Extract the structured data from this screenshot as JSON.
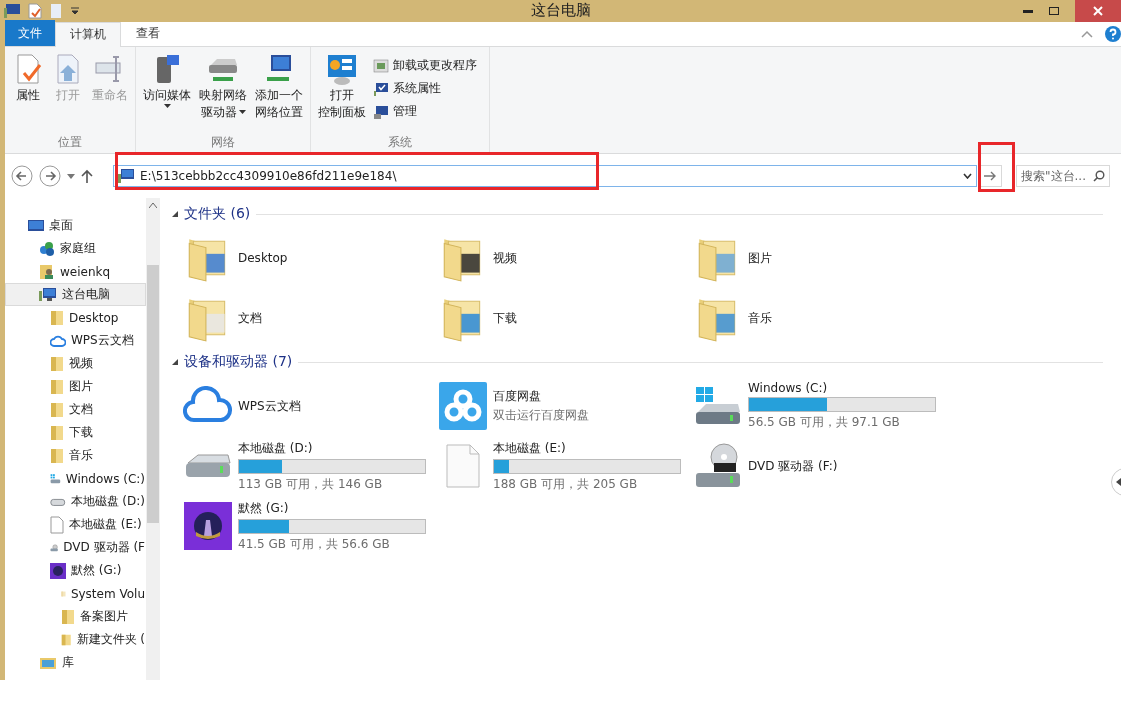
{
  "window": {
    "title": "这台电脑"
  },
  "ribbon_tabs": [
    {
      "label": "文件",
      "kind": "file",
      "selected": false
    },
    {
      "label": "计算机",
      "kind": "tab",
      "selected": true
    },
    {
      "label": "查看",
      "kind": "tab",
      "selected": false
    }
  ],
  "ribbon_groups": [
    {
      "label": "位置",
      "buttons": [
        {
          "kind": "large",
          "lines": [
            "属性"
          ],
          "disabled": false
        },
        {
          "kind": "large",
          "lines": [
            "打开"
          ],
          "disabled": true
        },
        {
          "kind": "large",
          "lines": [
            "重命名"
          ],
          "disabled": true
        }
      ]
    },
    {
      "label": "网络",
      "buttons": [
        {
          "kind": "large",
          "lines": [
            "访问媒体"
          ],
          "dropdown": true,
          "disabled": false
        },
        {
          "kind": "large",
          "lines": [
            "映射网络",
            "驱动器"
          ],
          "dropdown": true,
          "disabled": false
        },
        {
          "kind": "large",
          "lines": [
            "添加一个",
            "网络位置"
          ],
          "disabled": false
        }
      ]
    },
    {
      "label": "系统",
      "buttons": [
        {
          "kind": "large",
          "lines": [
            "打开",
            "控制面板"
          ],
          "disabled": false
        },
        {
          "kind": "small",
          "lines": [
            "卸载或更改程序"
          ],
          "disabled": false
        },
        {
          "kind": "small",
          "lines": [
            "系统属性"
          ],
          "disabled": false
        },
        {
          "kind": "small",
          "lines": [
            "管理"
          ],
          "disabled": false
        }
      ]
    }
  ],
  "address_bar": {
    "path": "E:\\513cebbb2cc4309910e86fd211e9e184\\"
  },
  "search": {
    "placeholder": "搜索\"这台..."
  },
  "nav_tree": [
    {
      "label": "桌面",
      "kind": "desktop",
      "selected": false,
      "children": [
        {
          "label": "家庭组",
          "kind": "homegroup",
          "selected": false
        },
        {
          "label": "weienkq",
          "kind": "user",
          "selected": false
        },
        {
          "label": "这台电脑",
          "kind": "computer",
          "selected": true,
          "children": [
            {
              "label": "Desktop",
              "kind": "folder",
              "selected": false
            },
            {
              "label": "WPS云文档",
              "kind": "cloud",
              "selected": false
            },
            {
              "label": "视频",
              "kind": "folder",
              "selected": false
            },
            {
              "label": "图片",
              "kind": "folder",
              "selected": false
            },
            {
              "label": "文档",
              "kind": "folder",
              "selected": false
            },
            {
              "label": "下载",
              "kind": "folder",
              "selected": false
            },
            {
              "label": "音乐",
              "kind": "folder",
              "selected": false
            },
            {
              "label": "Windows (C:)",
              "kind": "windrive",
              "selected": false
            },
            {
              "label": "本地磁盘 (D:)",
              "kind": "drive",
              "selected": false
            },
            {
              "label": "本地磁盘 (E:)",
              "kind": "file",
              "selected": false
            },
            {
              "label": "DVD 驱动器 (F",
              "kind": "optical",
              "selected": false
            },
            {
              "label": "默然 (G:)",
              "kind": "avatar",
              "selected": false,
              "children": [
                {
                  "label": "System Volu",
                  "kind": "paleFolder",
                  "selected": false
                },
                {
                  "label": "备案图片",
                  "kind": "folder",
                  "selected": false
                },
                {
                  "label": "新建文件夹 (",
                  "kind": "folder",
                  "selected": false
                }
              ]
            }
          ]
        },
        {
          "label": "库",
          "kind": "library",
          "selected": false
        }
      ]
    }
  ],
  "sections": [
    {
      "title": "文件夹 (6)",
      "items": [
        {
          "name": "Desktop",
          "kind": "folder"
        },
        {
          "name": "视频",
          "kind": "folder"
        },
        {
          "name": "图片",
          "kind": "folder"
        },
        {
          "name": "文档",
          "kind": "folder"
        },
        {
          "name": "下载",
          "kind": "folder"
        },
        {
          "name": "音乐",
          "kind": "folder"
        }
      ]
    },
    {
      "title": "设备和驱动器 (7)",
      "items": [
        {
          "name": "WPS云文档",
          "kind": "cloud"
        },
        {
          "name": "百度网盘",
          "kind": "app",
          "subtitle": "双击运行百度网盘"
        },
        {
          "name": "Windows (C:)",
          "kind": "windrive",
          "level": 0.42,
          "free": "56.5 GB 可用，共 97.1 GB"
        },
        {
          "name": "本地磁盘 (D:)",
          "kind": "drive",
          "level": 0.23,
          "free": "113 GB 可用，共 146 GB"
        },
        {
          "name": "本地磁盘 (E:)",
          "kind": "file",
          "level": 0.08,
          "free": "188 GB 可用，共 205 GB"
        },
        {
          "name": "DVD 驱动器 (F:)",
          "kind": "optical"
        },
        {
          "name": "默然 (G:)",
          "kind": "avatar",
          "level": 0.27,
          "free": "41.5 GB 可用，共 56.6 GB"
        }
      ]
    }
  ]
}
